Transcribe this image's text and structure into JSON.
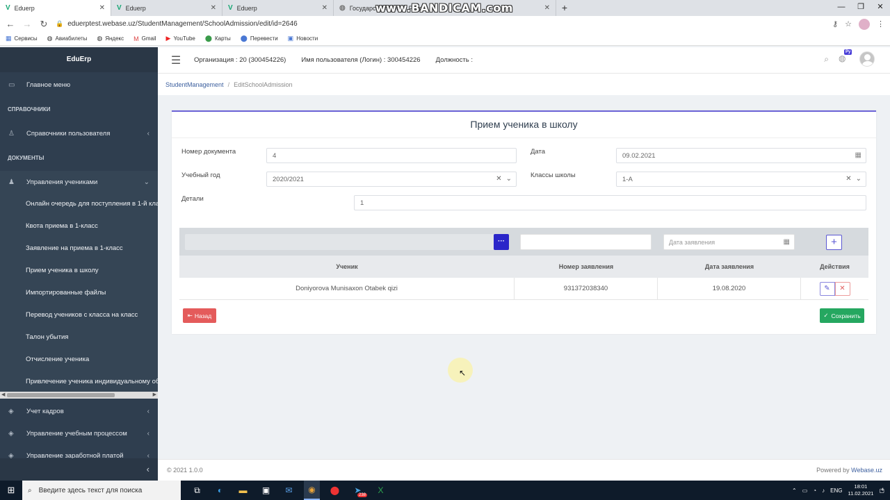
{
  "browser": {
    "tabs": [
      {
        "title": "Eduerp",
        "active": true
      },
      {
        "title": "Eduerp"
      },
      {
        "title": "Eduerp"
      },
      {
        "title": "Государс… комитет Респ…"
      }
    ],
    "watermark": "www.BANDICAM.com",
    "url": "eduerptest.webase.uz/StudentManagement/SchoolAdmission/edit/id=2646",
    "bookmarks": [
      "Сервисы",
      "Авиабилеты",
      "Яндекс",
      "Gmail",
      "YouTube",
      "Карты",
      "Перевести",
      "Новости"
    ]
  },
  "sidebar": {
    "brand": "EduErp",
    "main_menu": "Главное меню",
    "section_refs": "СПРАВОЧНИКИ",
    "user_refs": "Справочники пользователя",
    "section_docs": "ДОКУМЕНТЫ",
    "students_group": "Управления учениками",
    "sub_items": [
      "Онлайн очередь для поступления в 1-й класс",
      "Квота приема в 1-класс",
      "Заявление на приема в 1-класс",
      "Прием ученика в школу",
      "Импортированные файлы",
      "Перевод учеников с класса на класс",
      "Талон убытия",
      "Отчисление ученика",
      "Привлечение ученика индивидуальному обучению"
    ],
    "lower_items": [
      "Учет кадров",
      "Управление учебным процессом",
      "Управление заработной платой"
    ]
  },
  "header": {
    "org": "Организация : 20 (300454226)",
    "user": "Имя пользователя (Логин) : 300454226",
    "position": "Должность :",
    "lang_badge": "Ру"
  },
  "breadcrumb": {
    "parent": "StudentManagement",
    "current": "EditSchoolAdmission"
  },
  "form": {
    "title": "Прием ученика в школу",
    "doc_number_label": "Номер документа",
    "doc_number_value": "4",
    "date_label": "Дата",
    "date_value": "09.02.2021",
    "year_label": "Учебный год",
    "year_value": "2020/2021",
    "classes_label": "Классы школы",
    "classes_value": "1-А",
    "details_label": "Детали",
    "details_value": "1"
  },
  "grid": {
    "dots_label": "···",
    "date_placeholder": "Дата заявления",
    "columns": [
      "Ученик",
      "Номер заявления",
      "Дата заявления",
      "Действия"
    ],
    "rows": [
      {
        "student": "Doniyorova Munisaxon Otabek qizi",
        "number": "931372038340",
        "date": "19.08.2020"
      }
    ]
  },
  "buttons": {
    "back": "Назад",
    "save": "Сохранить"
  },
  "footer": {
    "copyright": "© 2021 1.0.0",
    "powered": "Powered by",
    "powered_brand": "Webase.uz"
  },
  "taskbar": {
    "search_placeholder": "Введите здесь текст для поиска",
    "badge": "238",
    "lang": "ENG",
    "time": "18:01",
    "date": "11.02.2021",
    "notif": "4"
  }
}
